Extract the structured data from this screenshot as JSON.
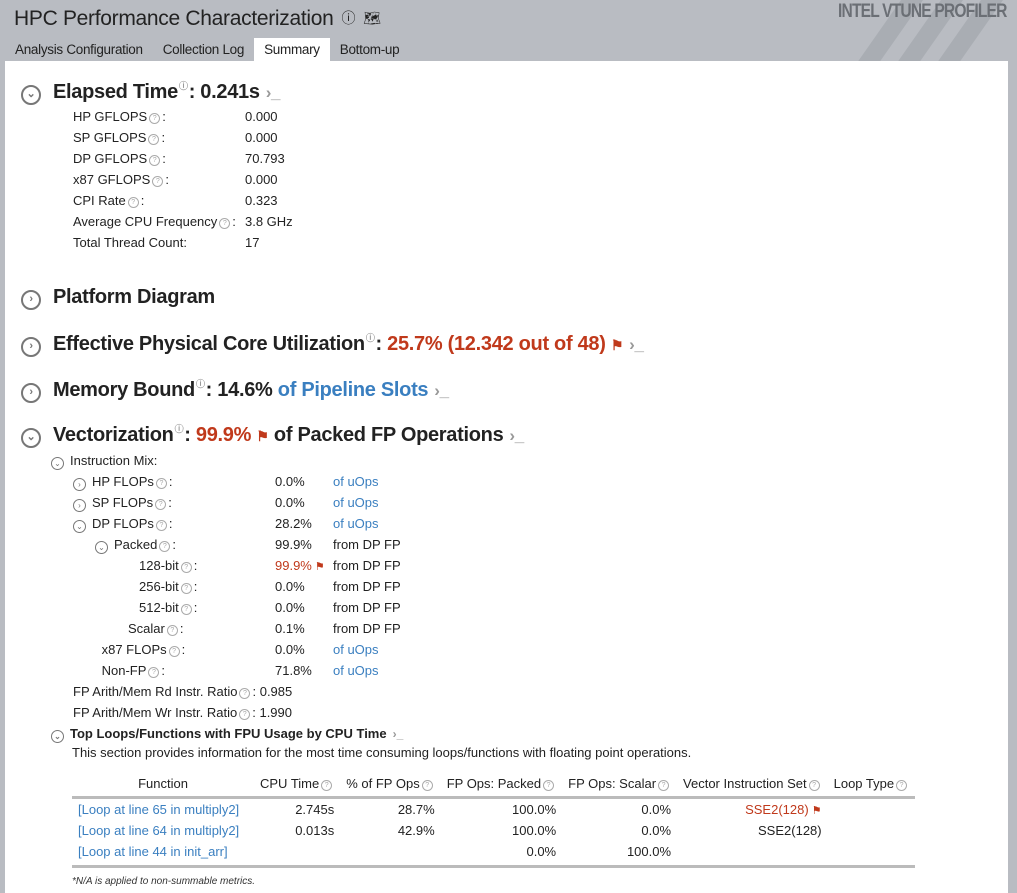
{
  "header": {
    "title": "HPC Performance Characterization",
    "brand": "INTEL VTUNE PROFILER",
    "tabs": [
      "Analysis Configuration",
      "Collection Log",
      "Summary",
      "Bottom-up"
    ],
    "active_tab": "Summary"
  },
  "elapsed": {
    "title": "Elapsed Time",
    "value": ": 0.241s",
    "metrics": [
      {
        "label": "HP GFLOPS",
        "help": true,
        "value": "0.000"
      },
      {
        "label": "SP GFLOPS",
        "help": true,
        "value": "0.000"
      },
      {
        "label": "DP GFLOPS",
        "help": true,
        "value": "70.793"
      },
      {
        "label": "x87 GFLOPS",
        "help": true,
        "value": "0.000"
      },
      {
        "label": "CPI Rate",
        "help": true,
        "value": "0.323"
      },
      {
        "label": "Average CPU Frequency",
        "help": true,
        "value": "3.8 GHz"
      },
      {
        "label": "Total Thread Count",
        "help": false,
        "value": "17"
      }
    ]
  },
  "platform": {
    "title": "Platform Diagram"
  },
  "core_util": {
    "title": "Effective Physical Core Utilization",
    "value": "25.7% (12.342 out of 48)"
  },
  "memory": {
    "title": "Memory Bound",
    "value": "14.6%",
    "suffix": "of Pipeline Slots"
  },
  "vector": {
    "title": "Vectorization",
    "value": "99.9%",
    "suffix": "of Packed FP Operations",
    "mix_title": "Instruction Mix:",
    "mix": [
      {
        "label": "HP FLOPs",
        "value": "0.0%",
        "unit": "of uOps",
        "indent": 1,
        "toggle": "›",
        "unit_blue": true
      },
      {
        "label": "SP FLOPs",
        "value": "0.0%",
        "unit": "of uOps",
        "indent": 1,
        "toggle": "›",
        "unit_blue": true
      },
      {
        "label": "DP FLOPs",
        "value": "28.2%",
        "unit": "of uOps",
        "indent": 1,
        "toggle": "⌄",
        "unit_blue": true
      },
      {
        "label": "Packed",
        "value": "99.9%",
        "unit": "from DP FP",
        "indent": 2,
        "toggle": "⌄"
      },
      {
        "label": "128-bit",
        "value": "99.9%",
        "unit": "from DP FP",
        "indent": 3,
        "flag": true
      },
      {
        "label": "256-bit",
        "value": "0.0%",
        "unit": "from DP FP",
        "indent": 3
      },
      {
        "label": "512-bit",
        "value": "0.0%",
        "unit": "from DP FP",
        "indent": 3
      },
      {
        "label": "Scalar",
        "value": "0.1%",
        "unit": "from DP FP",
        "indent": 2.5
      },
      {
        "label": "x87 FLOPs",
        "value": "0.0%",
        "unit": "of uOps",
        "indent": 1.3,
        "unit_blue": true
      },
      {
        "label": "Non-FP",
        "value": "71.8%",
        "unit": "of uOps",
        "indent": 1.3,
        "unit_blue": true
      }
    ],
    "ratios": [
      {
        "label": "FP Arith/Mem Rd Instr. Ratio",
        "value": "0.985"
      },
      {
        "label": "FP Arith/Mem Wr Instr. Ratio",
        "value": "1.990"
      }
    ],
    "top_title": "Top Loops/Functions with FPU Usage by CPU Time",
    "top_desc": "This section provides information for the most time consuming loops/functions with floating point operations.",
    "columns": [
      "Function",
      "CPU Time",
      "% of FP Ops",
      "FP Ops: Packed",
      "FP Ops: Scalar",
      "Vector Instruction Set",
      "Loop Type"
    ],
    "rows": [
      [
        "[Loop at line 65 in multiply2]",
        "2.745s",
        "28.7%",
        "100.0%",
        "0.0%",
        "SSE2(128)",
        ""
      ],
      [
        "[Loop at line 64 in multiply2]",
        "0.013s",
        "42.9%",
        "100.0%",
        "0.0%",
        "SSE2(128)",
        ""
      ],
      [
        "[Loop at line 44 in init_arr]",
        "",
        "",
        "0.0%",
        "100.0%",
        "",
        ""
      ]
    ],
    "footnote": "*N/A is applied to non-summable metrics."
  },
  "colors": {
    "accent_red": "#c0391b",
    "link_blue": "#3a7fc0",
    "header_bg": "#b9bcc2"
  }
}
